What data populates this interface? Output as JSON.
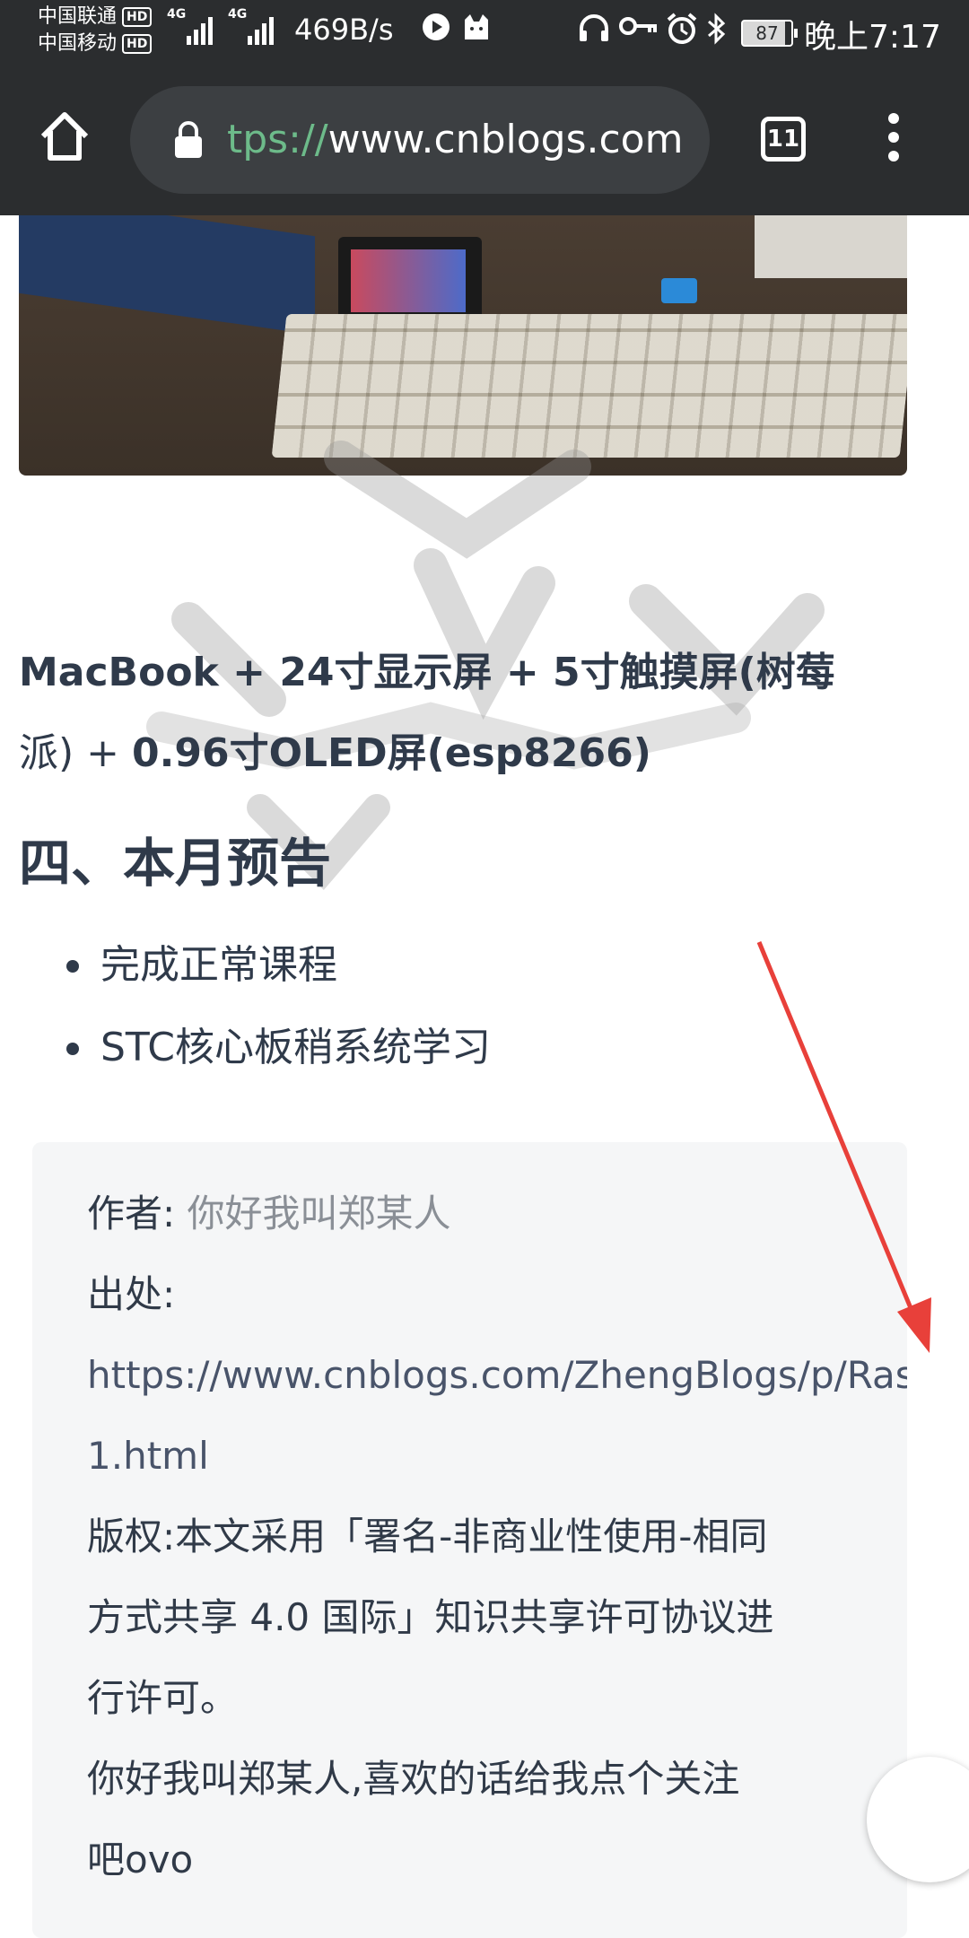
{
  "status_bar": {
    "carrier1": "中国联通",
    "carrier2": "中国移动",
    "hd_badge": "HD",
    "network1": "4G",
    "network2": "4G",
    "speed": "469B/s",
    "battery": "87",
    "time": "晚上7:17",
    "icons": [
      "play-icon",
      "cat-icon",
      "headphones-icon",
      "key-icon",
      "alarm-icon",
      "bluetooth-icon"
    ]
  },
  "browser": {
    "url_scheme": "tps://",
    "url_host": "www.cnblogs.com",
    "tab_count": "11",
    "icons": [
      "home-icon",
      "lock-icon",
      "tabs-icon",
      "more-vert-icon"
    ]
  },
  "article": {
    "hardware_line1_bold": "MacBook + 24寸显示屏 + 5寸触摸屏(树莓",
    "hardware_line2_pre": "派) + ",
    "hardware_line2_bold": "0.96寸OLED屏(esp8266)",
    "section_heading": "四、本月预告",
    "bullets": [
      "完成正常课程",
      "STC核心板稍系统学习"
    ],
    "info": {
      "author_label": "作者:",
      "author_value": "你好我叫郑某人",
      "source_label": "出处:",
      "source_url_line1": "https://www.cnblogs.com/ZhengBlogs/p/Raspberry",
      "source_url_line2": "1.html",
      "license_line1": "版权:本文采用「署名-非商业性使用-相同",
      "license_line2": "方式共享 4.0 国际」知识共享许可协议进",
      "license_line3": "行许可。",
      "closing_line1": "你好我叫郑某人,喜欢的话给我点个关注",
      "closing_line2": "吧ovo"
    }
  },
  "colors": {
    "toolbar_bg": "#2b2d2f",
    "omnibox_bg": "#3c3f42",
    "url_scheme": "#6dbb8a",
    "text": "#2f3a4a",
    "info_bg": "#f5f6f7",
    "arrow": "#e8403a"
  }
}
